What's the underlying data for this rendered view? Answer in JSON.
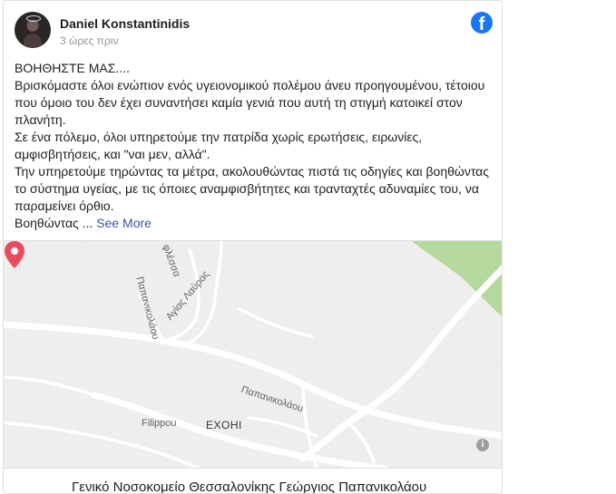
{
  "post": {
    "author": "Daniel Konstantinidis",
    "timestamp": "3 ώρες πριν",
    "text_lines": [
      "ΒΟΗΘΗΣΤΕ ΜΑΣ....",
      "Βρισκόμαστε όλοι ενώπιον ενός υγειονομικού πολέμου άνευ προηγουμένου, τέτοιου",
      "που όμοιο του δεν έχει συναντήσει καμία γενιά που αυτή τη στιγμή κατοικεί στον",
      "πλανήτη.",
      "Σε ένα πόλεμο, όλοι υπηρετούμε την πατρίδα χωρίς ερωτήσεις, ειρωνίες,",
      "αμφισβητήσεις, και \"ναι μεν, αλλά\".",
      "Την υπηρετούμε τηρώντας τα μέτρα, ακολουθώντας πιστά τις οδηγίες και βοηθώντας",
      "το σύστημα υγείας, με τις όποιες αναμφισβήτητες και τρανταχτές αδυναμίες του, να",
      "παραμείνει όρθιο."
    ],
    "last_line_prefix": "Βοηθώντας ...",
    "see_more": "See More"
  },
  "map": {
    "street_labels": [
      "φλέσσα",
      "Αγίας Λαύρας",
      "Παπανικολάου",
      "Παπανικολάου",
      "Filippou"
    ],
    "place_label": "EXOHI",
    "info_icon": "i",
    "pin_color": "#ea4c5f"
  },
  "footer": {
    "title": "Γενικό Νοσοκομείο Θεσσαλονίκης Γεώργιος Παπανικολάου"
  },
  "colors": {
    "facebook_blue": "#1877f2",
    "link": "#385898",
    "map_green": "#b5d99c"
  },
  "icons": {
    "brand": "facebook-logo-icon",
    "map_pin": "map-pin-icon",
    "info": "info-icon"
  }
}
